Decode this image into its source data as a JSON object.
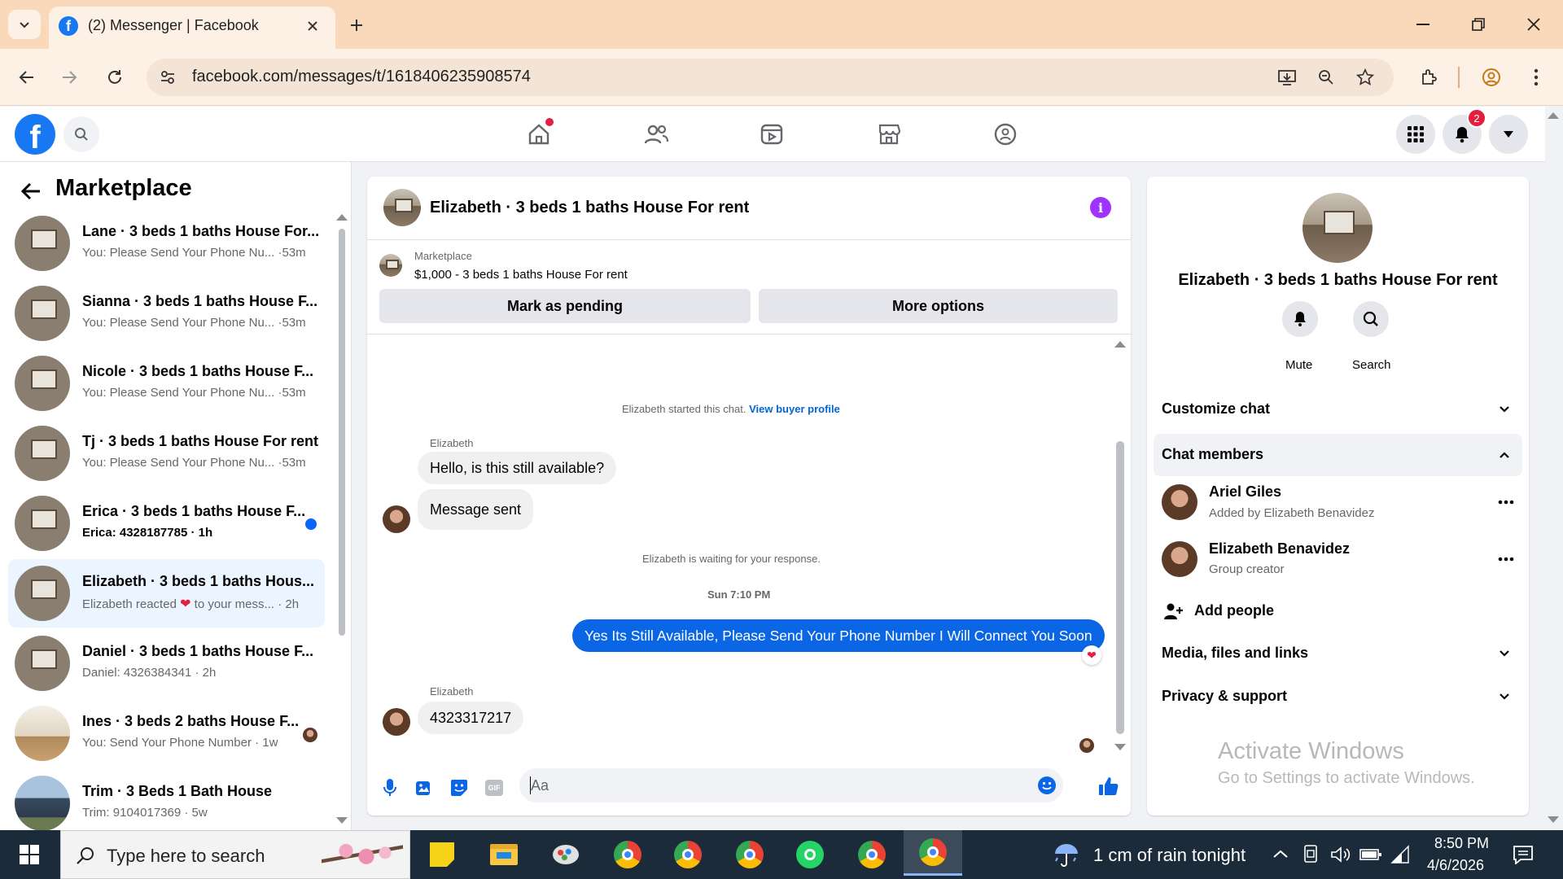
{
  "browser": {
    "tab_title": "(2) Messenger | Facebook",
    "url": "facebook.com/messages/t/1618406235908574"
  },
  "fb_header": {
    "notifications_badge": "2",
    "nav_icons": [
      "home-icon",
      "friends-icon",
      "watch-icon",
      "marketplace-icon",
      "groups-icon"
    ]
  },
  "sidebar": {
    "title": "Marketplace",
    "conversations": [
      {
        "name": "Lane · 3 beds 1 baths House For...",
        "preview": "You: Please Send Your Phone Nu... ·53m"
      },
      {
        "name": "Sianna · 3 beds 1 baths House F...",
        "preview": "You: Please Send Your Phone Nu... ·53m"
      },
      {
        "name": "Nicole · 3 beds 1 baths House F...",
        "preview": "You: Please Send Your Phone Nu... ·53m"
      },
      {
        "name": "Tj · 3 beds 1 baths House For rent",
        "preview": "You: Please Send Your Phone Nu... ·53m"
      },
      {
        "name": "Erica · 3 beds 1 baths House F...",
        "preview": "Erica: 4328187785 · 1h"
      },
      {
        "name": "Elizabeth · 3 beds 1 baths Hous...",
        "preview_a": "Elizabeth reacted",
        "preview_b": "to your mess... · 2h"
      },
      {
        "name": "Daniel · 3 beds 1 baths House F...",
        "preview": "Daniel: 4326384341 · 2h"
      },
      {
        "name": "Ines · 3 beds 2 baths House F...",
        "preview": "You: Send Your Phone Number · 1w"
      },
      {
        "name": "Trim · 3 Beds 1 Bath House",
        "preview": "Trim: 9104017369 · 5w"
      }
    ]
  },
  "chat": {
    "title": "Elizabeth · 3 beds 1 baths House For rent",
    "listing_source": "Marketplace",
    "listing_title": "$1,000 - 3 beds 1 baths House For rent",
    "mark_pending_label": "Mark as pending",
    "more_options_label": "More options",
    "started_text": "Elizabeth started this chat.",
    "view_profile_link": "View buyer profile",
    "sender_name": "Elizabeth",
    "msg1": "Hello, is this still available?",
    "msg2": "Message sent",
    "waiting_text": "Elizabeth is waiting for your response.",
    "timestamp": "Sun 7:10 PM",
    "my_msg": "Yes Its Still Available, Please Send Your Phone Number I Will Connect You Soon",
    "sender_name2": "Elizabeth",
    "msg3": "4323317217",
    "composer_placeholder": "Aa",
    "accent_color": "#0a66e4"
  },
  "right_panel": {
    "title": "Elizabeth · 3 beds 1 baths House For rent",
    "mute_label": "Mute",
    "search_label": "Search",
    "customize_chat": "Customize chat",
    "chat_members": "Chat members",
    "members": [
      {
        "name": "Ariel Giles",
        "role": "Added by Elizabeth Benavidez"
      },
      {
        "name": "Elizabeth Benavidez",
        "role": "Group creator"
      }
    ],
    "add_people": "Add people",
    "media_files": "Media, files and links",
    "privacy_support": "Privacy & support",
    "watermark_title": "Activate Windows",
    "watermark_sub": "Go to Settings to activate Windows."
  },
  "taskbar": {
    "search_placeholder": "Type here to search",
    "weather": "1 cm of rain tonight",
    "time": "8:50 PM",
    "date": "4/6/2026"
  }
}
